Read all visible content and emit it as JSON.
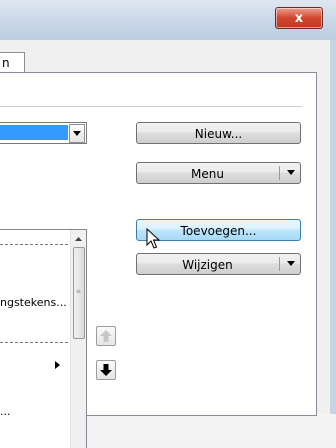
{
  "window": {
    "close_label": "x"
  },
  "tab": {
    "label": "n"
  },
  "buttons": {
    "new_label": "Nieuw...",
    "menu_label": "Menu",
    "add_label": "Toevoegen...",
    "modify_label": "Wijzigen"
  },
  "list": {
    "rows": [
      "ngstekens...",
      "..."
    ]
  },
  "icons": {
    "close": "close-icon",
    "dropdown": "chevron-down-icon",
    "up": "arrow-up-icon",
    "down": "arrow-down-icon",
    "submenu": "chevron-right-icon",
    "cursor": "mouse-cursor-icon"
  }
}
